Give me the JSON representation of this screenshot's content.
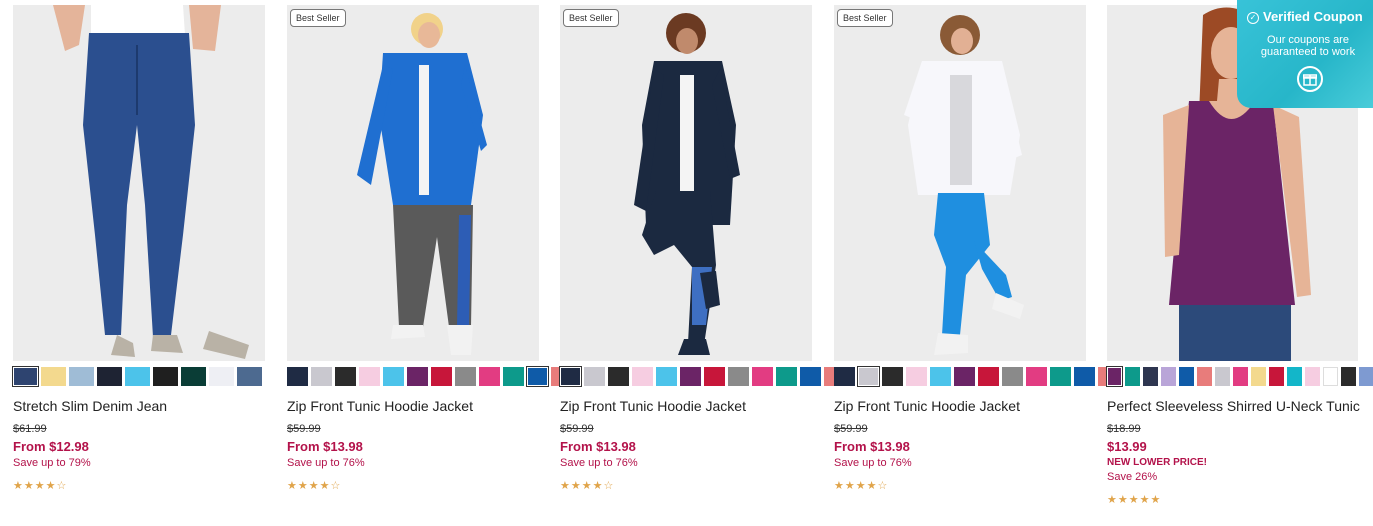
{
  "products": [
    {
      "name": "Stretch Slim Denim Jean",
      "badge": "",
      "was_price": "$61.99",
      "price": "From $12.98",
      "promo": "",
      "save": "Save up to 79%",
      "rating": 4,
      "stars": "★★★★☆",
      "swatches": [
        "#2e4470",
        "#f3d98e",
        "#9fbcd6",
        "#1e2333",
        "#4cc3ea",
        "#1f1f1f",
        "#0a3d36",
        "#eeeff4",
        "#4d6a90"
      ],
      "selected": 0,
      "image": "denim-jean-model-icon"
    },
    {
      "name": "Zip Front Tunic Hoodie Jacket",
      "badge": "Best Seller",
      "was_price": "$59.99",
      "price": "From $13.98",
      "promo": "",
      "save": "Save up to 76%",
      "rating": 4,
      "stars": "★★★★☆",
      "swatches": [
        "#1f2b44",
        "#c9c8cf",
        "#2b2b2b",
        "#f6cde1",
        "#4cc3ea",
        "#6b2466",
        "#c7163a",
        "#8a8a8a",
        "#e23c82",
        "#0d9a8b",
        "#0f5ba8",
        "#e87c7b"
      ],
      "selected": 10,
      "image": "blue-hoodie-model-icon"
    },
    {
      "name": "Zip Front Tunic Hoodie Jacket",
      "badge": "Best Seller",
      "was_price": "$59.99",
      "price": "From $13.98",
      "promo": "",
      "save": "Save up to 76%",
      "rating": 4,
      "stars": "★★★★☆",
      "swatches": [
        "#1f2b44",
        "#c9c8cf",
        "#2b2b2b",
        "#f6cde1",
        "#4cc3ea",
        "#6b2466",
        "#c7163a",
        "#8a8a8a",
        "#e23c82",
        "#0d9a8b",
        "#0f5ba8",
        "#e87c7b"
      ],
      "selected": 0,
      "image": "navy-hoodie-model-icon"
    },
    {
      "name": "Zip Front Tunic Hoodie Jacket",
      "badge": "Best Seller",
      "was_price": "$59.99",
      "price": "From $13.98",
      "promo": "",
      "save": "Save up to 76%",
      "rating": 4,
      "stars": "★★★★☆",
      "swatches": [
        "#1f2b44",
        "#c9c8cf",
        "#2b2b2b",
        "#f6cde1",
        "#4cc3ea",
        "#6b2466",
        "#c7163a",
        "#8a8a8a",
        "#e23c82",
        "#0d9a8b",
        "#0f5ba8",
        "#e87c7b"
      ],
      "selected": 1,
      "image": "white-hoodie-model-icon"
    },
    {
      "name": "Perfect Sleeveless Shirred U-Neck Tunic",
      "badge": "",
      "was_price": "$18.99",
      "price": "$13.99",
      "promo": "NEW LOWER PRICE!",
      "save": "Save 26%",
      "rating": 4.5,
      "stars": "★★★★★",
      "swatches": [
        "#6b2466",
        "#0d9a8b",
        "#2e3650",
        "#b9a5d8",
        "#0f5ba8",
        "#e87c7b",
        "#c9c8cf",
        "#e23c82",
        "#f3d98e",
        "#c7163a",
        "#13b6c9",
        "#f6cde1",
        "#ffffff",
        "#2b2b2b",
        "#7e9ad1"
      ],
      "selected": 0,
      "image": "purple-tunic-model-icon"
    }
  ],
  "coupon": {
    "title": "Verified Coupon",
    "subtitle": "Our coupons are guaranteed to work",
    "icon": "gift-icon"
  },
  "colors": {
    "price_red": "#b3124a",
    "star_gold": "#e0a44a",
    "coupon_teal": "#27b6c9"
  }
}
